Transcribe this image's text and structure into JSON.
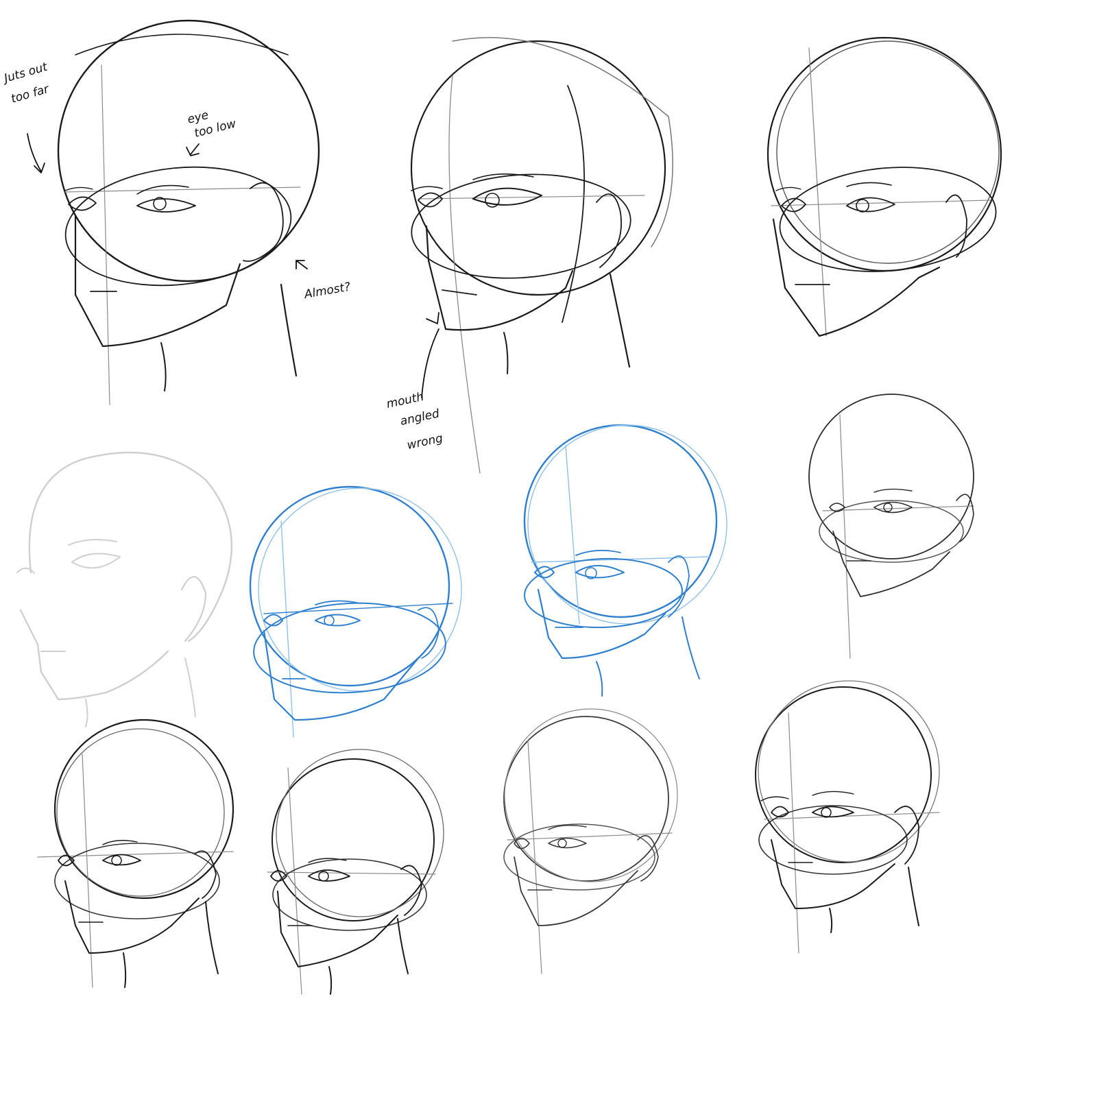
{
  "palette": {
    "ink": "#1a1a1a",
    "guide": "#8a8a8a",
    "blue": "#2f7fcf",
    "blue_light": "#8fc0ea",
    "ghost": "#cfcfcf"
  },
  "annotations": {
    "jut": [
      "Juts out",
      "too far"
    ],
    "eye": [
      "eye",
      "too low"
    ],
    "almost": "Almost?",
    "mouth": [
      "mouth",
      "angled",
      "wrong"
    ]
  },
  "sketches": [
    {
      "id": "head-1",
      "ink": "ink"
    },
    {
      "id": "head-2",
      "ink": "ink"
    },
    {
      "id": "head-3",
      "ink": "ink"
    },
    {
      "id": "reference-head",
      "ink": "ghost"
    },
    {
      "id": "head-blue-1",
      "ink": "blue"
    },
    {
      "id": "head-blue-2",
      "ink": "blue"
    },
    {
      "id": "head-small-right",
      "ink": "guide"
    },
    {
      "id": "head-bottom-1",
      "ink": "ink"
    },
    {
      "id": "head-bottom-2",
      "ink": "ink"
    },
    {
      "id": "head-bottom-3",
      "ink": "guide"
    },
    {
      "id": "head-bottom-4",
      "ink": "ink"
    }
  ]
}
